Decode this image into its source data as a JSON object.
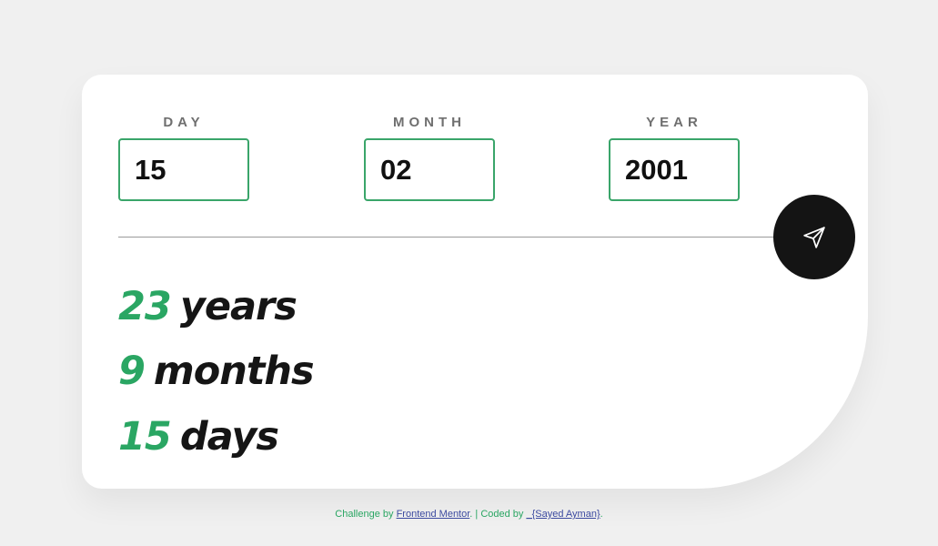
{
  "form": {
    "day": {
      "label": "DAY",
      "value": "15"
    },
    "month": {
      "label": "MONTH",
      "value": "02"
    },
    "year": {
      "label": "YEAR",
      "value": "2001"
    }
  },
  "submit_icon": "send-arrow-icon",
  "results": {
    "years": {
      "value": "23",
      "unit": "years"
    },
    "months": {
      "value": "9",
      "unit": "months"
    },
    "days": {
      "value": "15",
      "unit": "days"
    }
  },
  "footer": {
    "challenge_prefix": "Challenge by",
    "challenge_link": "Frontend Mentor",
    "coded_prefix": ". | Coded by",
    "coded_link": "_{Sayed Ayman}",
    "suffix": "."
  },
  "colors": {
    "accent": "#2aa663",
    "border": "#3aa56a",
    "button": "#141414",
    "background": "#f0f0f0",
    "link": "#3c4aa0"
  }
}
